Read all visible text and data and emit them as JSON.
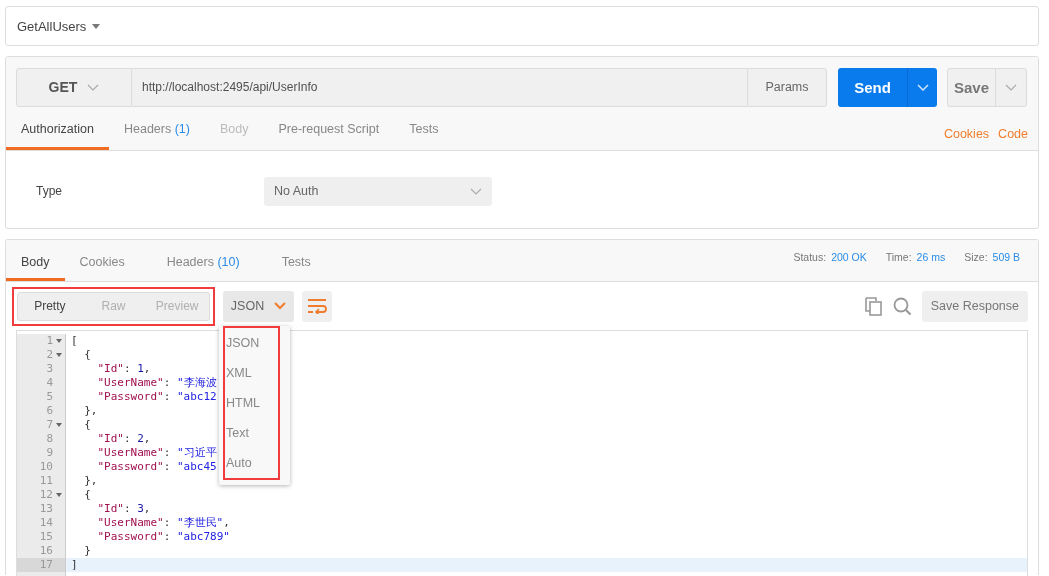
{
  "request_name": "GetAllUsers",
  "request": {
    "method": "GET",
    "url": "http://localhost:2495/api/UserInfo",
    "params_label": "Params",
    "send_label": "Send",
    "save_label": "Save"
  },
  "request_tabs": [
    {
      "label": "Authorization",
      "selected": true,
      "disabled": false
    },
    {
      "label": "Headers",
      "count": "(1)",
      "selected": false,
      "disabled": false
    },
    {
      "label": "Body",
      "selected": false,
      "disabled": true
    },
    {
      "label": "Pre-request Script",
      "selected": false,
      "disabled": false
    },
    {
      "label": "Tests",
      "selected": false,
      "disabled": false
    }
  ],
  "request_links": [
    "Cookies",
    "Code"
  ],
  "auth": {
    "label": "Type",
    "value": "No Auth"
  },
  "response_tabs": [
    {
      "label": "Body",
      "selected": true
    },
    {
      "label": "Cookies",
      "selected": false
    },
    {
      "label": "Headers",
      "count": "(10)",
      "selected": false
    },
    {
      "label": "Tests",
      "selected": false
    }
  ],
  "response_stats": [
    {
      "label": "Status:",
      "value": "200 OK"
    },
    {
      "label": "Time:",
      "value": "26 ms"
    },
    {
      "label": "Size:",
      "value": "509 B"
    }
  ],
  "view_modes": {
    "annotated": true,
    "items": [
      {
        "label": "Pretty",
        "selected": true
      },
      {
        "label": "Raw",
        "selected": false
      },
      {
        "label": "Preview",
        "selected": false
      }
    ]
  },
  "format": {
    "value": "JSON"
  },
  "format_menu": {
    "annotated": true,
    "items": [
      "JSON",
      "XML",
      "HTML",
      "Text",
      "Auto"
    ]
  },
  "save_response_label": "Save Response",
  "code_lines": [
    {
      "number": "1",
      "fold": true,
      "active": false,
      "tokens": [
        {
          "kind": "punct",
          "text": "["
        }
      ]
    },
    {
      "number": "2",
      "fold": true,
      "active": false,
      "tokens": [
        {
          "kind": "punct",
          "text": "  {"
        }
      ]
    },
    {
      "number": "3",
      "fold": false,
      "active": false,
      "tokens": [
        {
          "kind": "key",
          "text": "    \"Id\""
        },
        {
          "kind": "punct",
          "text": ": "
        },
        {
          "kind": "number",
          "text": "1"
        },
        {
          "kind": "punct",
          "text": ","
        }
      ]
    },
    {
      "number": "4",
      "fold": false,
      "active": false,
      "tokens": [
        {
          "kind": "key",
          "text": "    \"UserName\""
        },
        {
          "kind": "punct",
          "text": ": "
        },
        {
          "kind": "string",
          "text": "\"李海波"
        }
      ]
    },
    {
      "number": "5",
      "fold": false,
      "active": false,
      "tokens": [
        {
          "kind": "key",
          "text": "    \"Password\""
        },
        {
          "kind": "punct",
          "text": ": "
        },
        {
          "kind": "string",
          "text": "\"abc12"
        }
      ]
    },
    {
      "number": "6",
      "fold": false,
      "active": false,
      "tokens": [
        {
          "kind": "punct",
          "text": "  },"
        }
      ]
    },
    {
      "number": "7",
      "fold": true,
      "active": false,
      "tokens": [
        {
          "kind": "punct",
          "text": "  {"
        }
      ]
    },
    {
      "number": "8",
      "fold": false,
      "active": false,
      "tokens": [
        {
          "kind": "key",
          "text": "    \"Id\""
        },
        {
          "kind": "punct",
          "text": ": "
        },
        {
          "kind": "number",
          "text": "2"
        },
        {
          "kind": "punct",
          "text": ","
        }
      ]
    },
    {
      "number": "9",
      "fold": false,
      "active": false,
      "tokens": [
        {
          "kind": "key",
          "text": "    \"UserName\""
        },
        {
          "kind": "punct",
          "text": ": "
        },
        {
          "kind": "string",
          "text": "\"习近平"
        }
      ]
    },
    {
      "number": "10",
      "fold": false,
      "active": false,
      "tokens": [
        {
          "kind": "key",
          "text": "    \"Password\""
        },
        {
          "kind": "punct",
          "text": ": "
        },
        {
          "kind": "string",
          "text": "\"abc45"
        }
      ]
    },
    {
      "number": "11",
      "fold": false,
      "active": false,
      "tokens": [
        {
          "kind": "punct",
          "text": "  },"
        }
      ]
    },
    {
      "number": "12",
      "fold": true,
      "active": false,
      "tokens": [
        {
          "kind": "punct",
          "text": "  {"
        }
      ]
    },
    {
      "number": "13",
      "fold": false,
      "active": false,
      "tokens": [
        {
          "kind": "key",
          "text": "    \"Id\""
        },
        {
          "kind": "punct",
          "text": ": "
        },
        {
          "kind": "number",
          "text": "3"
        },
        {
          "kind": "punct",
          "text": ","
        }
      ]
    },
    {
      "number": "14",
      "fold": false,
      "active": false,
      "tokens": [
        {
          "kind": "key",
          "text": "    \"UserName\""
        },
        {
          "kind": "punct",
          "text": ": "
        },
        {
          "kind": "string",
          "text": "\"李世民\""
        },
        {
          "kind": "punct",
          "text": ","
        }
      ]
    },
    {
      "number": "15",
      "fold": false,
      "active": false,
      "tokens": [
        {
          "kind": "key",
          "text": "    \"Password\""
        },
        {
          "kind": "punct",
          "text": ": "
        },
        {
          "kind": "string",
          "text": "\"abc789\""
        }
      ]
    },
    {
      "number": "16",
      "fold": false,
      "active": false,
      "tokens": [
        {
          "kind": "punct",
          "text": "  }"
        }
      ]
    },
    {
      "number": "17",
      "fold": false,
      "active": true,
      "tokens": [
        {
          "kind": "punct",
          "text": "]"
        }
      ]
    }
  ]
}
